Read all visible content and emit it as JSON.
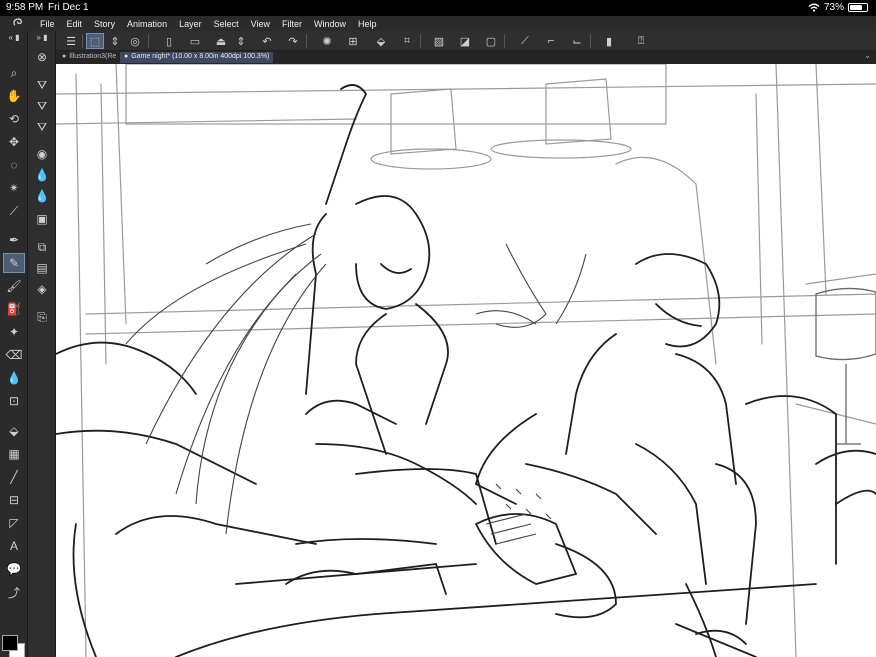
{
  "status_bar": {
    "time": "9:58 PM",
    "date": "Fri Dec 1",
    "battery_text": "73%",
    "battery_level": 0.73
  },
  "menu": {
    "logo_icon": "clip-studio-logo-icon",
    "items": [
      "File",
      "Edit",
      "Story",
      "Animation",
      "Layer",
      "Select",
      "View",
      "Filter",
      "Window",
      "Help"
    ]
  },
  "tabs": [
    {
      "label": "Illustration3(Re",
      "active": false
    },
    {
      "label": "Game night* (10.00 x 8.00in 400dpi 100.3%)",
      "active": true
    }
  ],
  "toolbar": {
    "icons": [
      "menu-icon",
      "selection-tool-icon",
      "up-down-icon",
      "zoom-icon",
      "new-file-icon",
      "open-folder-icon",
      "save-icon",
      "up-down-icon",
      "undo-icon",
      "redo-icon",
      "spinner-icon",
      "transform-icon",
      "fill-bucket-icon",
      "crop-icon",
      "layer-mask-icon",
      "layer-half-icon",
      "layer-frame-icon",
      "ruler-icon",
      "pen-curve-icon",
      "pen-line-icon",
      "phone-icon",
      "help-icon"
    ]
  },
  "tools": [
    "menu-dots-icon",
    "zoom-icon",
    "hand-icon",
    "rotate-icon",
    "move-icon",
    "lasso-icon",
    "magic-wand-icon",
    "eyedropper-icon",
    "pen-icon",
    "pencil-icon",
    "brush-icon",
    "airbrush-icon",
    "decoration-icon",
    "eraser-icon",
    "blend-icon",
    "figure-icon",
    "fill-icon",
    "gradient-icon",
    "line-icon",
    "frame-icon",
    "ruler-icon",
    "text-icon",
    "balloon-icon",
    "correct-line-icon"
  ],
  "sub_tools": [
    "subtool-circle-icon",
    "subtool-fill-1-icon",
    "subtool-fill-2-icon",
    "subtool-fill-3-icon",
    "subtool-drop-1-icon",
    "subtool-drop-2-icon",
    "subtool-drop-3-icon",
    "subtool-square-icon",
    "subtool-layers-1-icon",
    "subtool-layers-2-icon",
    "subtool-layers-3-icon",
    "subtool-page-icon"
  ],
  "colors": {
    "foreground": "#000000",
    "background": "#ffffff",
    "accent": "#4d5d75"
  }
}
